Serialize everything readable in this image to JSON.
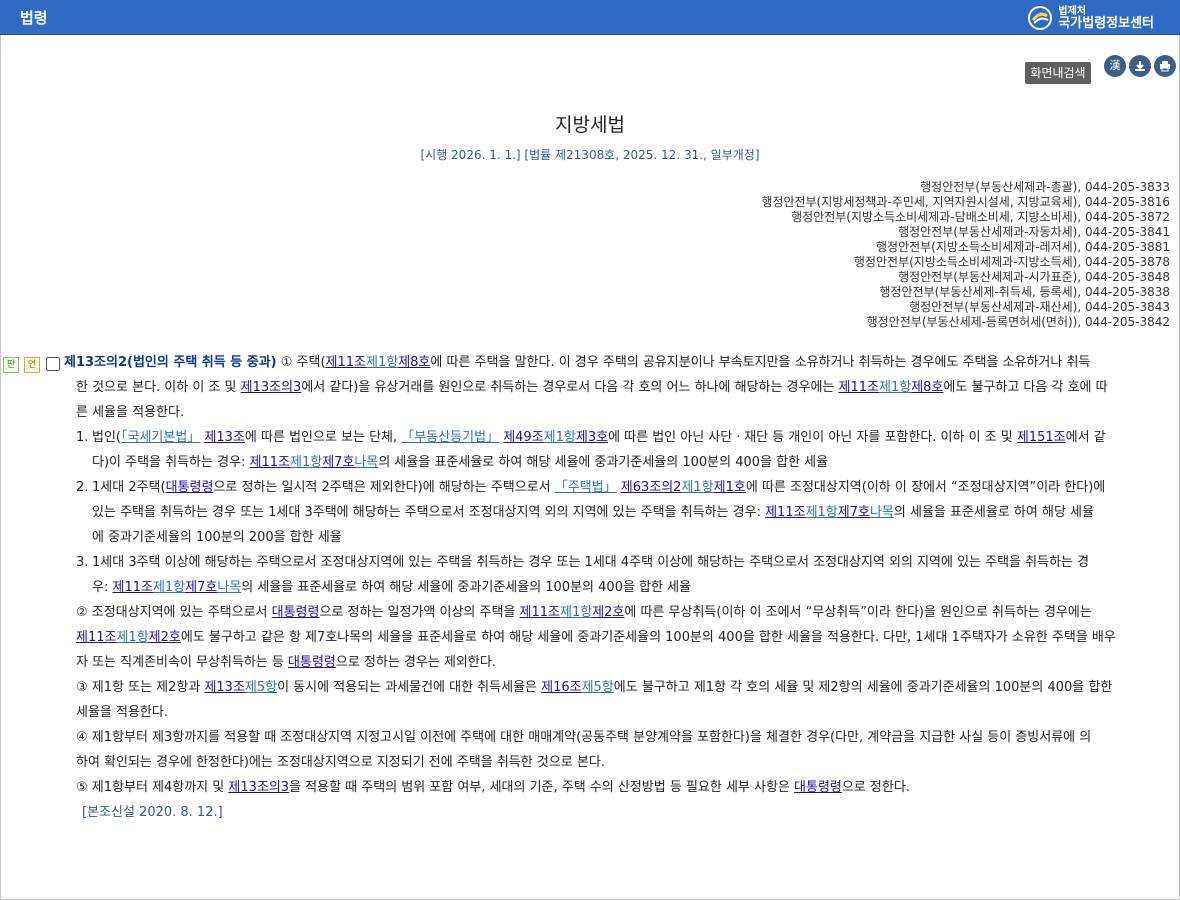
{
  "top": {
    "title": "법령",
    "brand_small": "법제처",
    "brand_big": "국가법령정보센터"
  },
  "toolbar": {
    "search": "화면내검색",
    "hanja": "漢"
  },
  "law": {
    "title": "지방세법",
    "sub": "[시행 2026. 1. 1.] [법률 제21308호, 2025. 12. 31., 일부개정]",
    "depts": [
      "행정안전부(부동산세제과-총괄), 044-205-3833",
      "행정안전부(지방세정책과-주민세, 지역자원시설세, 지방교육세), 044-205-3816",
      "행정안전부(지방소득소비세제과-담배소비세, 지방소비세), 044-205-3872",
      "행정안전부(부동산세제과-자동차세), 044-205-3841",
      "행정안전부(지방소득소비세제과-레저세), 044-205-3881",
      "행정안전부(지방소득소비세제과-지방소득세), 044-205-3878",
      "행정안전부(부동산세제과-시가표준), 044-205-3848",
      "행정안전부(부동산세제-취득세, 등록세), 044-205-3838",
      "행정안전부(부동산세제과-재산세), 044-205-3843",
      "행정안전부(부동산세제-등록면허세(면허)), 044-205-3842"
    ]
  },
  "article": {
    "badge1": "판",
    "badge2": "연",
    "heading": "제13조의2(법인의 주택 취득 등 중과)",
    "p1_lead": "① 주택(",
    "l_113": "제11조",
    "l_113_2": "제1항",
    "l_113_3": "제8호",
    "p1_a": "에 따른 주택을 말한다. 이 경우 주택의 공유지분이나 부속토지만을 소유하거나 취득하는 경우에도 주택을 소유하거나 취득",
    "p1_b": "한 것으로 본다. 이하 이 조 및 ",
    "l_1332": "제13조의3",
    "p1_c": "에서 같다)을 유상거래를 원인으로 취득하는 경우로서 다음 각 호의 어느 하나에 해당하는 경우에는 ",
    "p1_d": "에도 불구하고 다음 각 호에 따",
    "p1_e": "른 세율을 적용한다.",
    "i1_num": "1.",
    "i1_a": "법인(",
    "i1_l1": "「국세기본법」",
    "i1_l2": "제13조",
    "i1_b": "에 따른 법인으로 보는 단체, ",
    "i1_l3": "「부동산등기법」",
    "i1_l4": "제49조",
    "i1_l5": "제1항",
    "i1_l6": "제3호",
    "i1_c": "에 따른 법인 아닌 사단ㆍ재단 등 개인이 아닌 자를 포함한다. 이하 이 조 및 ",
    "i1_l7": "제151조",
    "i1_d": "에서 같",
    "i1_e": "다)이 주택을 취득하는 경우: ",
    "l_7": "제7호",
    "l_na": "나목",
    "i1_f": "의 세율을 표준세율로 하여 해당 세율에 중과기준세율의 100분의 400을 합한 세율",
    "i2_num": "2.",
    "i2_a": "1세대 2주택(",
    "l_pres": "대통령령",
    "i2_b": "으로 정하는 일시적 2주택은 제외한다)에 해당하는 주택으로서 ",
    "i2_l1": "「주택법」",
    "i2_l2": "제63조의2",
    "i2_l3": "제1항",
    "i2_l4": "제1호",
    "i2_c": "에 따른 조정대상지역(이하 이 장에서 “조정대상지역”이라 한다)에",
    "i2_d": "있는 주택을 취득하는 경우 또는 1세대 3주택에 해당하는 주택으로서 조정대상지역 외의 지역에 있는 주택을 취득하는 경우: ",
    "i2_e": "의 세율을 표준세율로 하여 해당 세율",
    "i2_f": "에 중과기준세율의 100분의 200을 합한 세율",
    "i3_num": "3.",
    "i3_a": "1세대 3주택 이상에 해당하는 주택으로서 조정대상지역에 있는 주택을 취득하는 경우 또는 1세대 4주택 이상에 해당하는 주택으로서 조정대상지역 외의 지역에 있는 주택을 취득하는 경",
    "i3_b": "우: ",
    "i3_c": "의 세율을 표준세율로 하여 해당 세율에 중과기준세율의 100분의 400을 합한 세율",
    "p2_a": "② 조정대상지역에 있는 주택으로서 ",
    "p2_b": "으로 정하는 일정가액 이상의 주택을 ",
    "l_2": "제2호",
    "p2_c": "에 따른 무상취득(이하 이 조에서 “무상취득”이라 한다)을 원인으로 취득하는 경우에는",
    "p2_d": "에도 불구하고 같은 항 제7호나목의 세율을 표준세율로 하여 해당 세율에 중과기준세율의 100분의 400을 합한 세율을 적용한다. 다만, 1세대 1주택자가 소유한 주택을 배우",
    "p2_e": "자 또는 직계존비속이 무상취득하는 등 ",
    "p2_f": "으로 정하는 경우는 제외한다.",
    "p3_a": "③ 제1항 또는 제2항과 ",
    "l_13": "제13조",
    "l_5": "제5항",
    "p3_b": "이 동시에 적용되는 과세물건에 대한 취득세율은 ",
    "l_16": "제16조",
    "p3_c": "에도 불구하고 제1항 각 호의 세율 및 제2항의 세율에 중과기준세율의 100분의 400을 합한",
    "p3_d": "세율을 적용한다.",
    "p4_a": "④ 제1항부터 제3항까지를 적용할 때 조정대상지역 지정고시일 이전에 주택에 대한 매매계약(공동주택 분양계약을 포함한다)을 체결한 경우(다만, 계약금을 지급한 사실 등이 증빙서류에 의",
    "p4_b": "하여 확인되는 경우에 한정한다)에는 조정대상지역으로 지정되기 전에 주택을 취득한 것으로 본다.",
    "p5_a": "⑤ 제1항부터 제4항까지 및 ",
    "p5_b": "을 적용할 때 주택의 범위 포함 여부, 세대의 기준, 주택 수의 산정방법 등 필요한 세부 사항은 ",
    "p5_c": "으로 정한다.",
    "note": "[본조신설 2020. 8. 12.]"
  }
}
